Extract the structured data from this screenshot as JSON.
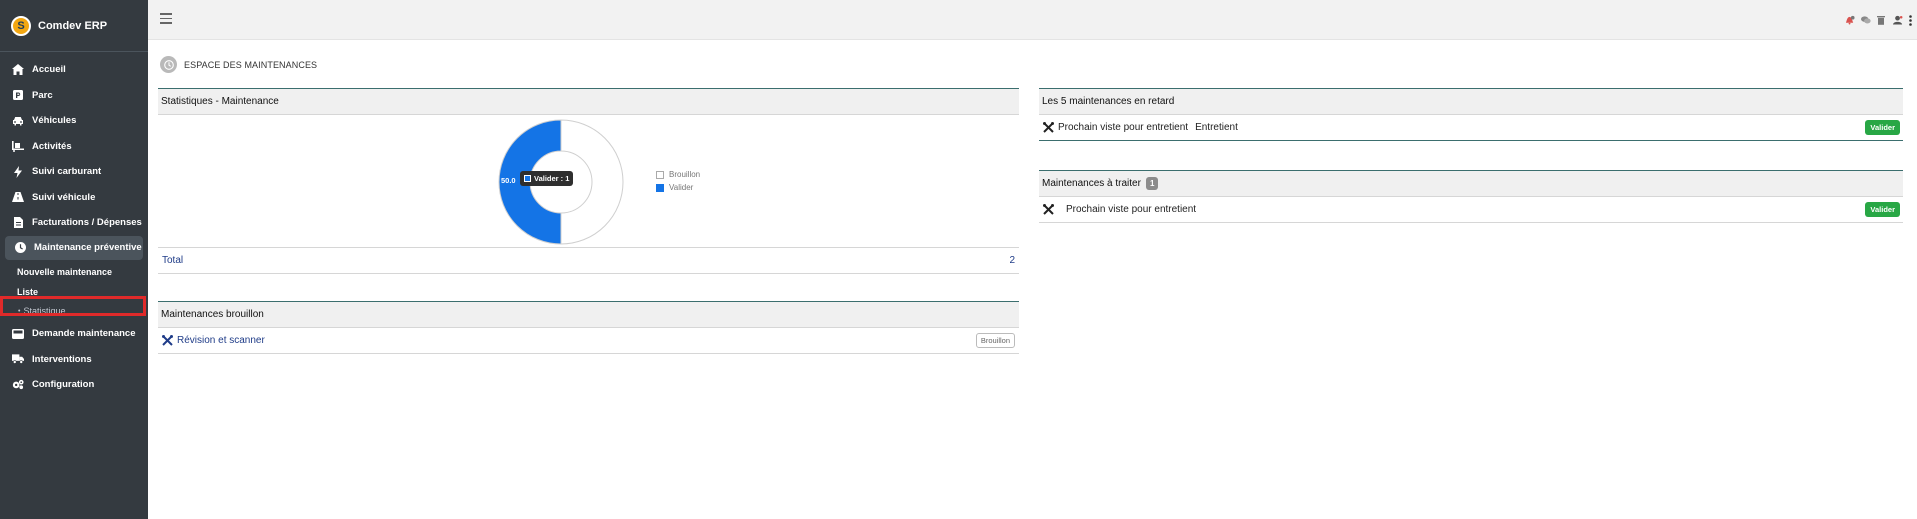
{
  "app": {
    "name": "Comdev ERP",
    "logo_text": "S"
  },
  "sidebar": {
    "items": [
      {
        "label": "Accueil",
        "icon": "home-icon"
      },
      {
        "label": "Parc",
        "icon": "parking-icon"
      },
      {
        "label": "Véhicules",
        "icon": "car-icon"
      },
      {
        "label": "Activités",
        "icon": "truck-loading-icon"
      },
      {
        "label": "Suivi carburant",
        "icon": "bolt-icon"
      },
      {
        "label": "Suivi véhicule",
        "icon": "road-icon"
      },
      {
        "label": "Facturations / Dépenses",
        "icon": "invoice-icon"
      },
      {
        "label": "Maintenance préventive",
        "icon": "clock-icon"
      }
    ],
    "sub_items": [
      {
        "label": "Nouvelle maintenance"
      },
      {
        "label": "Liste"
      },
      {
        "label": "Statistique",
        "bullet": "•"
      }
    ],
    "items_after": [
      {
        "label": "Demande maintenance",
        "icon": "inbox-icon"
      },
      {
        "label": "Interventions",
        "icon": "truck-icon"
      },
      {
        "label": "Configuration",
        "icon": "cogs-icon"
      }
    ]
  },
  "page": {
    "title": "ESPACE DES MAINTENANCES"
  },
  "stats": {
    "title": "Statistiques - Maintenance",
    "total_label": "Total",
    "total_value": "2",
    "tooltip": "Valider : 1",
    "slice_label": "50.0",
    "legend": [
      {
        "label": "Brouillon",
        "color": "#ffffff"
      },
      {
        "label": "Valider",
        "color": "#1474e6"
      }
    ]
  },
  "chart_data": {
    "type": "pie",
    "categories": [
      "Brouillon",
      "Valider"
    ],
    "values": [
      1,
      1
    ],
    "title": "",
    "total": 2
  },
  "brouillon": {
    "title": "Maintenances brouillon",
    "rows": [
      {
        "label": "Révision et scanner",
        "status": "Brouillon"
      }
    ]
  },
  "retard": {
    "title": "Les 5 maintenances en retard",
    "rows": [
      {
        "label": "Prochain viste pour entretient",
        "type": "Entretient",
        "status": "Valider"
      }
    ]
  },
  "traiter": {
    "title": "Maintenances à traiter",
    "count": "1",
    "rows": [
      {
        "label": "Prochain viste pour entretient",
        "status": "Valider"
      }
    ]
  },
  "colors": {
    "sidebar_bg": "#343a40",
    "accent_blue": "#1474e6",
    "success": "#28a745",
    "panel_border": "#3b6e6e"
  }
}
